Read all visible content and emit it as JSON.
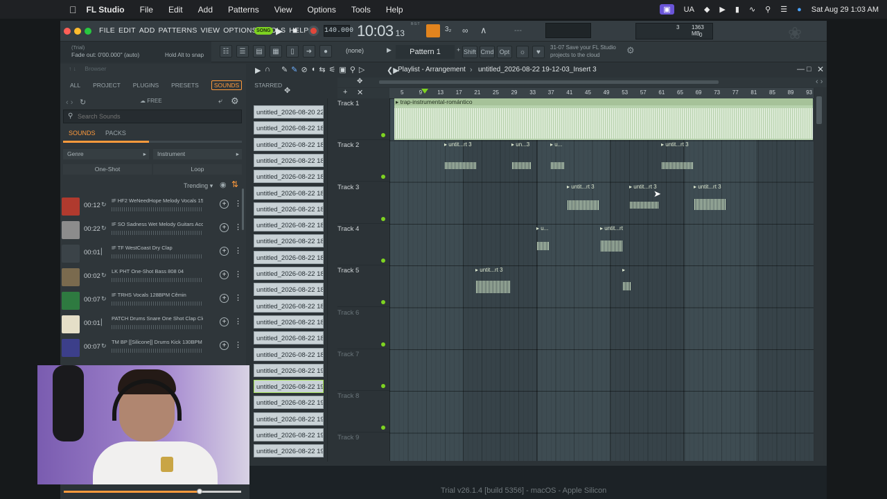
{
  "mac_menubar": {
    "app": "FL Studio",
    "items": [
      "File",
      "Edit",
      "Add",
      "Patterns",
      "View",
      "Options",
      "Tools",
      "Help"
    ],
    "input_source": "UA",
    "datetime": "Sat Aug 29  1:03 AM"
  },
  "fl_menu": [
    "FILE",
    "EDIT",
    "ADD",
    "PATTERNS",
    "VIEW",
    "OPTIONS",
    "TOOLS",
    "HELP"
  ],
  "transport": {
    "mode": "SONG",
    "tempo": "140.000",
    "time": "10:03",
    "time_sub": "13",
    "time_label": "B:S:T",
    "cpu_value": "3",
    "memory": "1363 MB",
    "voices": "0"
  },
  "hint": {
    "line1": "(Trial)",
    "line2": "Fade out: 0'00.000\" (auto)",
    "right": "Hold Alt to snap"
  },
  "pattern_select": "(none)",
  "pattern_label": "Pattern 1",
  "mod_keys": [
    "Shift",
    "Cmd",
    "Opt"
  ],
  "news": {
    "line1": "31-07  Save your FL Studio",
    "line2": "projects to the cloud"
  },
  "browser": {
    "title": "Browser",
    "tabs": [
      "ALL",
      "PROJECT",
      "PLUGINS",
      "PRESETS",
      "SOUNDS",
      "STARRED"
    ],
    "active_tab": "SOUNDS",
    "free_label": "FREE",
    "search_placeholder": "Search Sounds",
    "subtabs": [
      "SOUNDS",
      "PACKS"
    ],
    "filters": [
      "Genre",
      "Instrument"
    ],
    "toggles": [
      "One-Shot",
      "Loop"
    ],
    "sort": "Trending",
    "sounds": [
      {
        "dur": "00:12",
        "name": "IF HF2 WeNeedHope Melody Vocals 15...",
        "color": "#b03a2e"
      },
      {
        "dur": "00:22",
        "name": "IF SO Sadness Wet Melody Guitars Aco...",
        "color": "#8c8c8c"
      },
      {
        "dur": "00:01",
        "name": "IF TF WestCoast Dry Clap",
        "color": "#3b4348"
      },
      {
        "dur": "00:02",
        "name": "LK PHT One-Shot Bass 808 04",
        "color": "#7a6a4e"
      },
      {
        "dur": "00:07",
        "name": "IF TRHS Vocals 128BPM Cêmin",
        "color": "#2e7a40"
      },
      {
        "dur": "00:01",
        "name": "PATCH Drums Snare One Shot Clap Clean",
        "color": "#e5dfc8"
      },
      {
        "dur": "00:07",
        "name": "TM BP [[Silicone]] Drums Kick 130BPM",
        "color": "#3c3f8a"
      }
    ]
  },
  "playlist": {
    "title": "Playlist - Arrangement",
    "breadcrumb": "untitled_2026-08-22 19-12-03_Insert 3",
    "ruler": [
      "5",
      "9",
      "13",
      "17",
      "21",
      "25",
      "29",
      "33",
      "37",
      "41",
      "45",
      "49",
      "53",
      "57",
      "61",
      "65",
      "69",
      "73",
      "77",
      "81",
      "85",
      "89",
      "93"
    ],
    "tracks": [
      "Track 1",
      "Track 2",
      "Track 3",
      "Track 4",
      "Track 5",
      "Track 6",
      "Track 7",
      "Track 8",
      "Track 9"
    ],
    "audio_clip_name": "trap-instrumental-romántico",
    "clip_labels": {
      "full": "untit...rt 3",
      "short": "un...3",
      "tiny": "u..."
    }
  },
  "files": [
    "untitled_2026-08-20 22...",
    "untitled_2026-08-22 18...",
    "untitled_2026-08-22 18...",
    "untitled_2026-08-22 18...",
    "untitled_2026-08-22 18...",
    "untitled_2026-08-22 18...",
    "untitled_2026-08-22 18...",
    "untitled_2026-08-22 18...",
    "untitled_2026-08-22 18...",
    "untitled_2026-08-22 18...",
    "untitled_2026-08-22 18...",
    "untitled_2026-08-22 18...",
    "untitled_2026-08-22 18...",
    "untitled_2026-08-22 18...",
    "untitled_2026-08-22 18...",
    "untitled_2026-08-22 18...",
    "untitled_2026-08-22 19...",
    "untitled_2026-08-22 19...",
    "untitled_2026-08-22 19...",
    "untitled_2026-08-22 19...",
    "untitled_2026-08-22 19...",
    "untitled_2026-08-22 19..."
  ],
  "selected_file_index": 17,
  "status_bar": "Trial v26.1.4 [build 5356] - macOS - Apple Silicon",
  "colors": {
    "accent": "#ff9a3c",
    "green": "#7ed321",
    "clip": "#a6c99a"
  }
}
